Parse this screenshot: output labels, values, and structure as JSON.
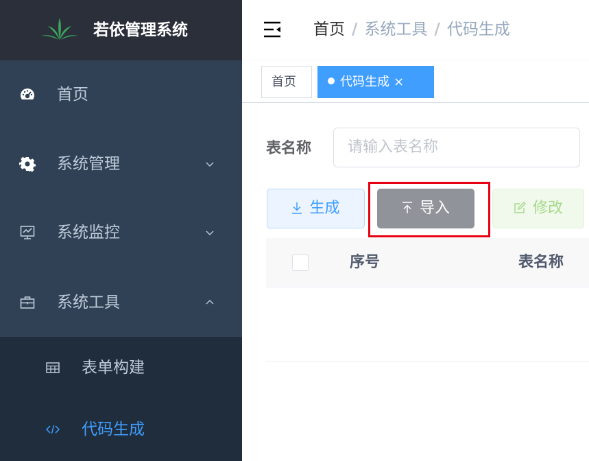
{
  "app": {
    "title": "若依管理系统"
  },
  "sidebar": {
    "items": [
      {
        "label": "首页",
        "icon": "dashboard-icon"
      },
      {
        "label": "系统管理",
        "icon": "gear-icon"
      },
      {
        "label": "系统监控",
        "icon": "monitor-icon"
      },
      {
        "label": "系统工具",
        "icon": "toolbox-icon"
      }
    ],
    "subitems": [
      {
        "label": "表单构建",
        "icon": "table-grid-icon"
      },
      {
        "label": "代码生成",
        "icon": "code-icon"
      }
    ],
    "colors": {
      "background": "#304156",
      "submenu_background": "#1f2d3d",
      "text": "#bfcbd9",
      "active": "#409eff"
    }
  },
  "breadcrumb": {
    "items": [
      "首页",
      "系统工具",
      "代码生成"
    ],
    "separator": "/"
  },
  "tags": {
    "home": "首页",
    "active": "代码生成",
    "close": "×"
  },
  "search": {
    "label": "表名称",
    "placeholder": "请输入表名称"
  },
  "toolbar": {
    "generate_label": "生成",
    "import_label": "导入",
    "edit_label": "修改"
  },
  "table": {
    "headers": [
      "序号",
      "表名称"
    ]
  }
}
